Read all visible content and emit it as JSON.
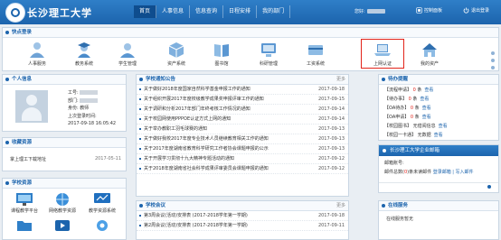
{
  "header": {
    "school_name": "长沙理工大学",
    "nav": [
      "首页",
      "人事信息",
      "信息查询",
      "日程安排",
      "我的部门"
    ],
    "user_prefix": "您好:",
    "control_panel": "控制面板",
    "logout": "退出登录"
  },
  "quick_access": {
    "title": "快点登录",
    "items": [
      "人事服务",
      "教务系统",
      "学生管理",
      "资产系统",
      "图书馆",
      "科研管理",
      "工资系统",
      "上网认证",
      "我的资产"
    ]
  },
  "personal": {
    "title": "个人信息",
    "id_label": "工号:",
    "dept_label": "部门:",
    "title_label": "身份:",
    "title_value": "教师",
    "last_login_label": "上次登录时间:",
    "last_login_value": "2017-09-18 16:05:42"
  },
  "collection": {
    "title": "收藏资源",
    "item": "掌上理工下载地址",
    "item_date": "2017-05-11"
  },
  "resources": {
    "title": "学校资源",
    "items": [
      "课程教学平台",
      "网络教学资源",
      "教学资源系统",
      "",
      "",
      ""
    ]
  },
  "news": {
    "title": "学校通知公告",
    "more": "更多",
    "items": [
      {
        "title": "关于做好2018年度国家自然科学基金申报工作的通知",
        "date": "2017-09-18"
      },
      {
        "title": "关于组织开展2017年度校级教学成果奖申报评审工作的通知",
        "date": "2017-09-15"
      },
      {
        "title": "关于调研和分析2017年部门年终考核工作情况的通知",
        "date": "2017-09-14"
      },
      {
        "title": "关于校园网使用PPPOE认证方式上网的通知",
        "date": "2017-09-14"
      },
      {
        "title": "关于举办教职工羽毛球赛的通知",
        "date": "2017-09-13"
      },
      {
        "title": "关于做好我校2017年度专业技术人员继续教育相关工作的通知",
        "date": "2017-09-13"
      },
      {
        "title": "关于2017年度湖南省教育科学研究工作者协会课题申报的公示",
        "date": "2017-09-13"
      },
      {
        "title": "关于开展学习贯彻十九大精神专题活动的通知",
        "date": "2017-09-12"
      },
      {
        "title": "关于2018年度湖南省社会科学成果评审委员会课题申报的通知",
        "date": "2017-09-12"
      }
    ]
  },
  "meetings": {
    "title": "学校会议",
    "more": "更多",
    "items": [
      {
        "title": "第3周会议(活动)安排表 (2017-2018学年第一学期)",
        "date": "2017-09-18"
      },
      {
        "title": "第2周会议(活动)安排表 (2017-2018学年第一学期)",
        "date": "2017-09-11"
      }
    ]
  },
  "todo": {
    "title": "待办提醒",
    "items": [
      {
        "label": "【流程申请】",
        "count": "0",
        "unit": "条",
        "link": "查看"
      },
      {
        "label": "【待办事】",
        "count": "0",
        "unit": "条",
        "link": "查看"
      },
      {
        "label": "【OA待办】",
        "count": "0",
        "unit": "条",
        "link": "查看"
      },
      {
        "label": "【OA申请】",
        "count": "0",
        "unit": "条",
        "link": "查看"
      },
      {
        "label": "【校园图书】",
        "count": "",
        "unit": "无借阅信息",
        "link": "查看"
      },
      {
        "label": "【校园一卡通】",
        "count": "",
        "unit": "无数据",
        "link": "查看"
      }
    ]
  },
  "announcement": {
    "title": "长沙理工大学企业邮箱",
    "line1": "邮箱账号:",
    "line2_prefix": "邮件总数(",
    "line2_count": "0",
    "line2_suffix": ")条未读邮件",
    "line2_links": "登录邮箱 | 写入邮件"
  },
  "online": {
    "title": "在线服务",
    "text": "在线服务暂无"
  },
  "colors": {
    "header_blue": "#1c64ad",
    "highlight_red": "#e2231a"
  }
}
